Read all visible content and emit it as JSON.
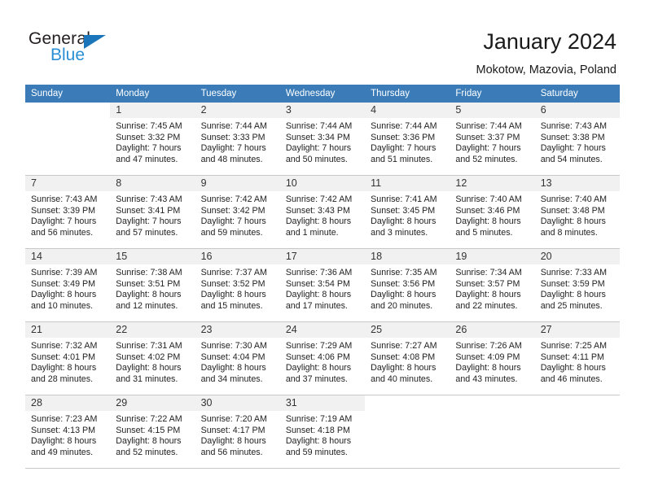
{
  "brand": {
    "name_part1": "General",
    "name_part2": "Blue"
  },
  "header": {
    "title": "January 2024",
    "subtitle": "Mokotow, Mazovia, Poland"
  },
  "colors": {
    "header_blue": "#3b7cb8",
    "logo_blue": "#2a8fd4",
    "daynum_bg": "#f1f1f1",
    "grid_line": "#c8c8c8"
  },
  "weekdays": [
    "Sunday",
    "Monday",
    "Tuesday",
    "Wednesday",
    "Thursday",
    "Friday",
    "Saturday"
  ],
  "weeks": [
    [
      {
        "day": "",
        "lines": []
      },
      {
        "day": "1",
        "lines": [
          "Sunrise: 7:45 AM",
          "Sunset: 3:32 PM",
          "Daylight: 7 hours",
          "and 47 minutes."
        ]
      },
      {
        "day": "2",
        "lines": [
          "Sunrise: 7:44 AM",
          "Sunset: 3:33 PM",
          "Daylight: 7 hours",
          "and 48 minutes."
        ]
      },
      {
        "day": "3",
        "lines": [
          "Sunrise: 7:44 AM",
          "Sunset: 3:34 PM",
          "Daylight: 7 hours",
          "and 50 minutes."
        ]
      },
      {
        "day": "4",
        "lines": [
          "Sunrise: 7:44 AM",
          "Sunset: 3:36 PM",
          "Daylight: 7 hours",
          "and 51 minutes."
        ]
      },
      {
        "day": "5",
        "lines": [
          "Sunrise: 7:44 AM",
          "Sunset: 3:37 PM",
          "Daylight: 7 hours",
          "and 52 minutes."
        ]
      },
      {
        "day": "6",
        "lines": [
          "Sunrise: 7:43 AM",
          "Sunset: 3:38 PM",
          "Daylight: 7 hours",
          "and 54 minutes."
        ]
      }
    ],
    [
      {
        "day": "7",
        "lines": [
          "Sunrise: 7:43 AM",
          "Sunset: 3:39 PM",
          "Daylight: 7 hours",
          "and 56 minutes."
        ]
      },
      {
        "day": "8",
        "lines": [
          "Sunrise: 7:43 AM",
          "Sunset: 3:41 PM",
          "Daylight: 7 hours",
          "and 57 minutes."
        ]
      },
      {
        "day": "9",
        "lines": [
          "Sunrise: 7:42 AM",
          "Sunset: 3:42 PM",
          "Daylight: 7 hours",
          "and 59 minutes."
        ]
      },
      {
        "day": "10",
        "lines": [
          "Sunrise: 7:42 AM",
          "Sunset: 3:43 PM",
          "Daylight: 8 hours",
          "and 1 minute."
        ]
      },
      {
        "day": "11",
        "lines": [
          "Sunrise: 7:41 AM",
          "Sunset: 3:45 PM",
          "Daylight: 8 hours",
          "and 3 minutes."
        ]
      },
      {
        "day": "12",
        "lines": [
          "Sunrise: 7:40 AM",
          "Sunset: 3:46 PM",
          "Daylight: 8 hours",
          "and 5 minutes."
        ]
      },
      {
        "day": "13",
        "lines": [
          "Sunrise: 7:40 AM",
          "Sunset: 3:48 PM",
          "Daylight: 8 hours",
          "and 8 minutes."
        ]
      }
    ],
    [
      {
        "day": "14",
        "lines": [
          "Sunrise: 7:39 AM",
          "Sunset: 3:49 PM",
          "Daylight: 8 hours",
          "and 10 minutes."
        ]
      },
      {
        "day": "15",
        "lines": [
          "Sunrise: 7:38 AM",
          "Sunset: 3:51 PM",
          "Daylight: 8 hours",
          "and 12 minutes."
        ]
      },
      {
        "day": "16",
        "lines": [
          "Sunrise: 7:37 AM",
          "Sunset: 3:52 PM",
          "Daylight: 8 hours",
          "and 15 minutes."
        ]
      },
      {
        "day": "17",
        "lines": [
          "Sunrise: 7:36 AM",
          "Sunset: 3:54 PM",
          "Daylight: 8 hours",
          "and 17 minutes."
        ]
      },
      {
        "day": "18",
        "lines": [
          "Sunrise: 7:35 AM",
          "Sunset: 3:56 PM",
          "Daylight: 8 hours",
          "and 20 minutes."
        ]
      },
      {
        "day": "19",
        "lines": [
          "Sunrise: 7:34 AM",
          "Sunset: 3:57 PM",
          "Daylight: 8 hours",
          "and 22 minutes."
        ]
      },
      {
        "day": "20",
        "lines": [
          "Sunrise: 7:33 AM",
          "Sunset: 3:59 PM",
          "Daylight: 8 hours",
          "and 25 minutes."
        ]
      }
    ],
    [
      {
        "day": "21",
        "lines": [
          "Sunrise: 7:32 AM",
          "Sunset: 4:01 PM",
          "Daylight: 8 hours",
          "and 28 minutes."
        ]
      },
      {
        "day": "22",
        "lines": [
          "Sunrise: 7:31 AM",
          "Sunset: 4:02 PM",
          "Daylight: 8 hours",
          "and 31 minutes."
        ]
      },
      {
        "day": "23",
        "lines": [
          "Sunrise: 7:30 AM",
          "Sunset: 4:04 PM",
          "Daylight: 8 hours",
          "and 34 minutes."
        ]
      },
      {
        "day": "24",
        "lines": [
          "Sunrise: 7:29 AM",
          "Sunset: 4:06 PM",
          "Daylight: 8 hours",
          "and 37 minutes."
        ]
      },
      {
        "day": "25",
        "lines": [
          "Sunrise: 7:27 AM",
          "Sunset: 4:08 PM",
          "Daylight: 8 hours",
          "and 40 minutes."
        ]
      },
      {
        "day": "26",
        "lines": [
          "Sunrise: 7:26 AM",
          "Sunset: 4:09 PM",
          "Daylight: 8 hours",
          "and 43 minutes."
        ]
      },
      {
        "day": "27",
        "lines": [
          "Sunrise: 7:25 AM",
          "Sunset: 4:11 PM",
          "Daylight: 8 hours",
          "and 46 minutes."
        ]
      }
    ],
    [
      {
        "day": "28",
        "lines": [
          "Sunrise: 7:23 AM",
          "Sunset: 4:13 PM",
          "Daylight: 8 hours",
          "and 49 minutes."
        ]
      },
      {
        "day": "29",
        "lines": [
          "Sunrise: 7:22 AM",
          "Sunset: 4:15 PM",
          "Daylight: 8 hours",
          "and 52 minutes."
        ]
      },
      {
        "day": "30",
        "lines": [
          "Sunrise: 7:20 AM",
          "Sunset: 4:17 PM",
          "Daylight: 8 hours",
          "and 56 minutes."
        ]
      },
      {
        "day": "31",
        "lines": [
          "Sunrise: 7:19 AM",
          "Sunset: 4:18 PM",
          "Daylight: 8 hours",
          "and 59 minutes."
        ]
      },
      {
        "day": "",
        "lines": []
      },
      {
        "day": "",
        "lines": []
      },
      {
        "day": "",
        "lines": []
      }
    ]
  ]
}
